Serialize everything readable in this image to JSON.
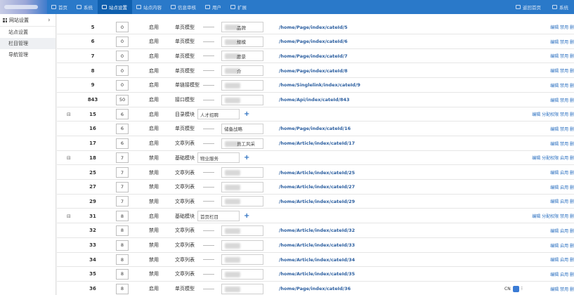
{
  "header": {
    "nav": [
      {
        "label": "首页",
        "icon": "home-icon"
      },
      {
        "label": "系统",
        "icon": "system-icon"
      },
      {
        "label": "站点设置",
        "icon": "monitor-icon",
        "active": true
      },
      {
        "label": "站点内容",
        "icon": "content-icon"
      },
      {
        "label": "信息审核",
        "icon": "lock-icon"
      },
      {
        "label": "用户",
        "icon": "user-icon"
      },
      {
        "label": "扩展",
        "icon": "cloud-icon"
      }
    ],
    "right": [
      {
        "label": "返回首页",
        "icon": "return-icon"
      },
      {
        "label": "系统",
        "icon": "person-icon"
      }
    ]
  },
  "sidebar": {
    "title": "网站设置",
    "items": [
      {
        "label": "站点设置"
      },
      {
        "label": "栏目管理",
        "active": true
      },
      {
        "label": "导航管理"
      }
    ]
  },
  "table": {
    "rows": [
      {
        "toggle": "",
        "id": "5",
        "sort": "0",
        "status": "启用",
        "model": "单页模型",
        "name": "",
        "name_suffix": "品牌",
        "url": "/home/Page/index/cateId/5",
        "actions": "编辑 禁用 删"
      },
      {
        "toggle": "",
        "id": "6",
        "sort": "0",
        "status": "启用",
        "model": "单页模型",
        "name": "",
        "name_suffix": "规模",
        "url": "/home/Page/index/cateId/6",
        "actions": "编辑 禁用 删"
      },
      {
        "toggle": "",
        "id": "7",
        "sort": "0",
        "status": "启用",
        "model": "单页模型",
        "name": "",
        "name_suffix": "愿景",
        "url": "/home/Page/index/cateId/7",
        "actions": "编辑 禁用 删"
      },
      {
        "toggle": "",
        "id": "8",
        "sort": "0",
        "status": "启用",
        "model": "单页模型",
        "name": "",
        "name_suffix": "介",
        "url": "/home/Page/index/cateId/8",
        "actions": "编辑 禁用 删"
      },
      {
        "toggle": "",
        "id": "9",
        "sort": "0",
        "status": "启用",
        "model": "单链接模型",
        "name": "",
        "name_suffix": "",
        "url": "/home/Singlelink/index/cateId/9",
        "actions": "编辑 禁用 删"
      },
      {
        "toggle": "",
        "id": "843",
        "sort": "50",
        "status": "启用",
        "model": "接口模型",
        "name": "",
        "name_suffix": "",
        "url": "/home/Api/index/cateId/843",
        "actions": "编辑 禁用 删"
      },
      {
        "toggle": "⊟",
        "id": "15",
        "sort": "6",
        "status": "启用",
        "model": "目录模块",
        "name": "人才招聘",
        "name_suffix": "",
        "url": "",
        "actions": "编辑 分配权限 禁用 删",
        "level1": true
      },
      {
        "toggle": "",
        "id": "16",
        "sort": "6",
        "status": "启用",
        "model": "单页模型",
        "name": "储备战略",
        "name_suffix": "",
        "url": "/home/Page/index/cateId/16",
        "actions": "编辑 禁用 删"
      },
      {
        "toggle": "",
        "id": "17",
        "sort": "6",
        "status": "启用",
        "model": "文章列表",
        "name": "",
        "name_suffix": "员工风采",
        "url": "/home/Article/index/cateId/17",
        "actions": "编辑 禁用 删"
      },
      {
        "toggle": "⊟",
        "id": "18",
        "sort": "7",
        "status": "禁用",
        "model": "基础模块",
        "name": "物业服务",
        "name_suffix": "",
        "url": "",
        "actions": "编辑 分配权限 启用 删",
        "level1": true
      },
      {
        "toggle": "",
        "id": "25",
        "sort": "7",
        "status": "禁用",
        "model": "文章列表",
        "name": "",
        "name_suffix": "",
        "url": "/home/Article/index/cateId/25",
        "actions": "编辑 启用 删"
      },
      {
        "toggle": "",
        "id": "27",
        "sort": "7",
        "status": "禁用",
        "model": "文章列表",
        "name": "",
        "name_suffix": "",
        "url": "/home/Article/index/cateId/27",
        "actions": "编辑 启用 删"
      },
      {
        "toggle": "",
        "id": "29",
        "sort": "7",
        "status": "禁用",
        "model": "文章列表",
        "name": "",
        "name_suffix": "",
        "url": "/home/Article/index/cateId/29",
        "actions": "编辑 启用 删"
      },
      {
        "toggle": "⊟",
        "id": "31",
        "sort": "8",
        "status": "启用",
        "model": "基础模块",
        "name": "首页栏目",
        "name_suffix": "",
        "url": "",
        "actions": "编辑 分配权限 禁用 删",
        "level1": true
      },
      {
        "toggle": "",
        "id": "32",
        "sort": "8",
        "status": "禁用",
        "model": "文章列表",
        "name": "",
        "name_suffix": "",
        "url": "/home/Article/index/cateId/32",
        "actions": "编辑 启用 删"
      },
      {
        "toggle": "",
        "id": "33",
        "sort": "8",
        "status": "禁用",
        "model": "文章列表",
        "name": "",
        "name_suffix": "",
        "url": "/home/Article/index/cateId/33",
        "actions": "编辑 启用 删"
      },
      {
        "toggle": "",
        "id": "34",
        "sort": "8",
        "status": "禁用",
        "model": "文章列表",
        "name": "",
        "name_suffix": "",
        "url": "/home/Article/index/cateId/34",
        "actions": "编辑 启用 删"
      },
      {
        "toggle": "",
        "id": "35",
        "sort": "8",
        "status": "禁用",
        "model": "文章列表",
        "name": "",
        "name_suffix": "",
        "url": "/home/Article/index/cateId/35",
        "actions": "编辑 启用 删"
      },
      {
        "toggle": "",
        "id": "36",
        "sort": "8",
        "status": "启用",
        "model": "单页模型",
        "name": "",
        "name_suffix": "",
        "url": "/home/Page/index/cateId/36",
        "actions": "编辑 禁用 删"
      }
    ]
  },
  "ime": {
    "label": "CN"
  },
  "colors": {
    "topbar": "#2a79c9",
    "active_nav": "#0f5fae",
    "link": "#2c5fa0"
  }
}
